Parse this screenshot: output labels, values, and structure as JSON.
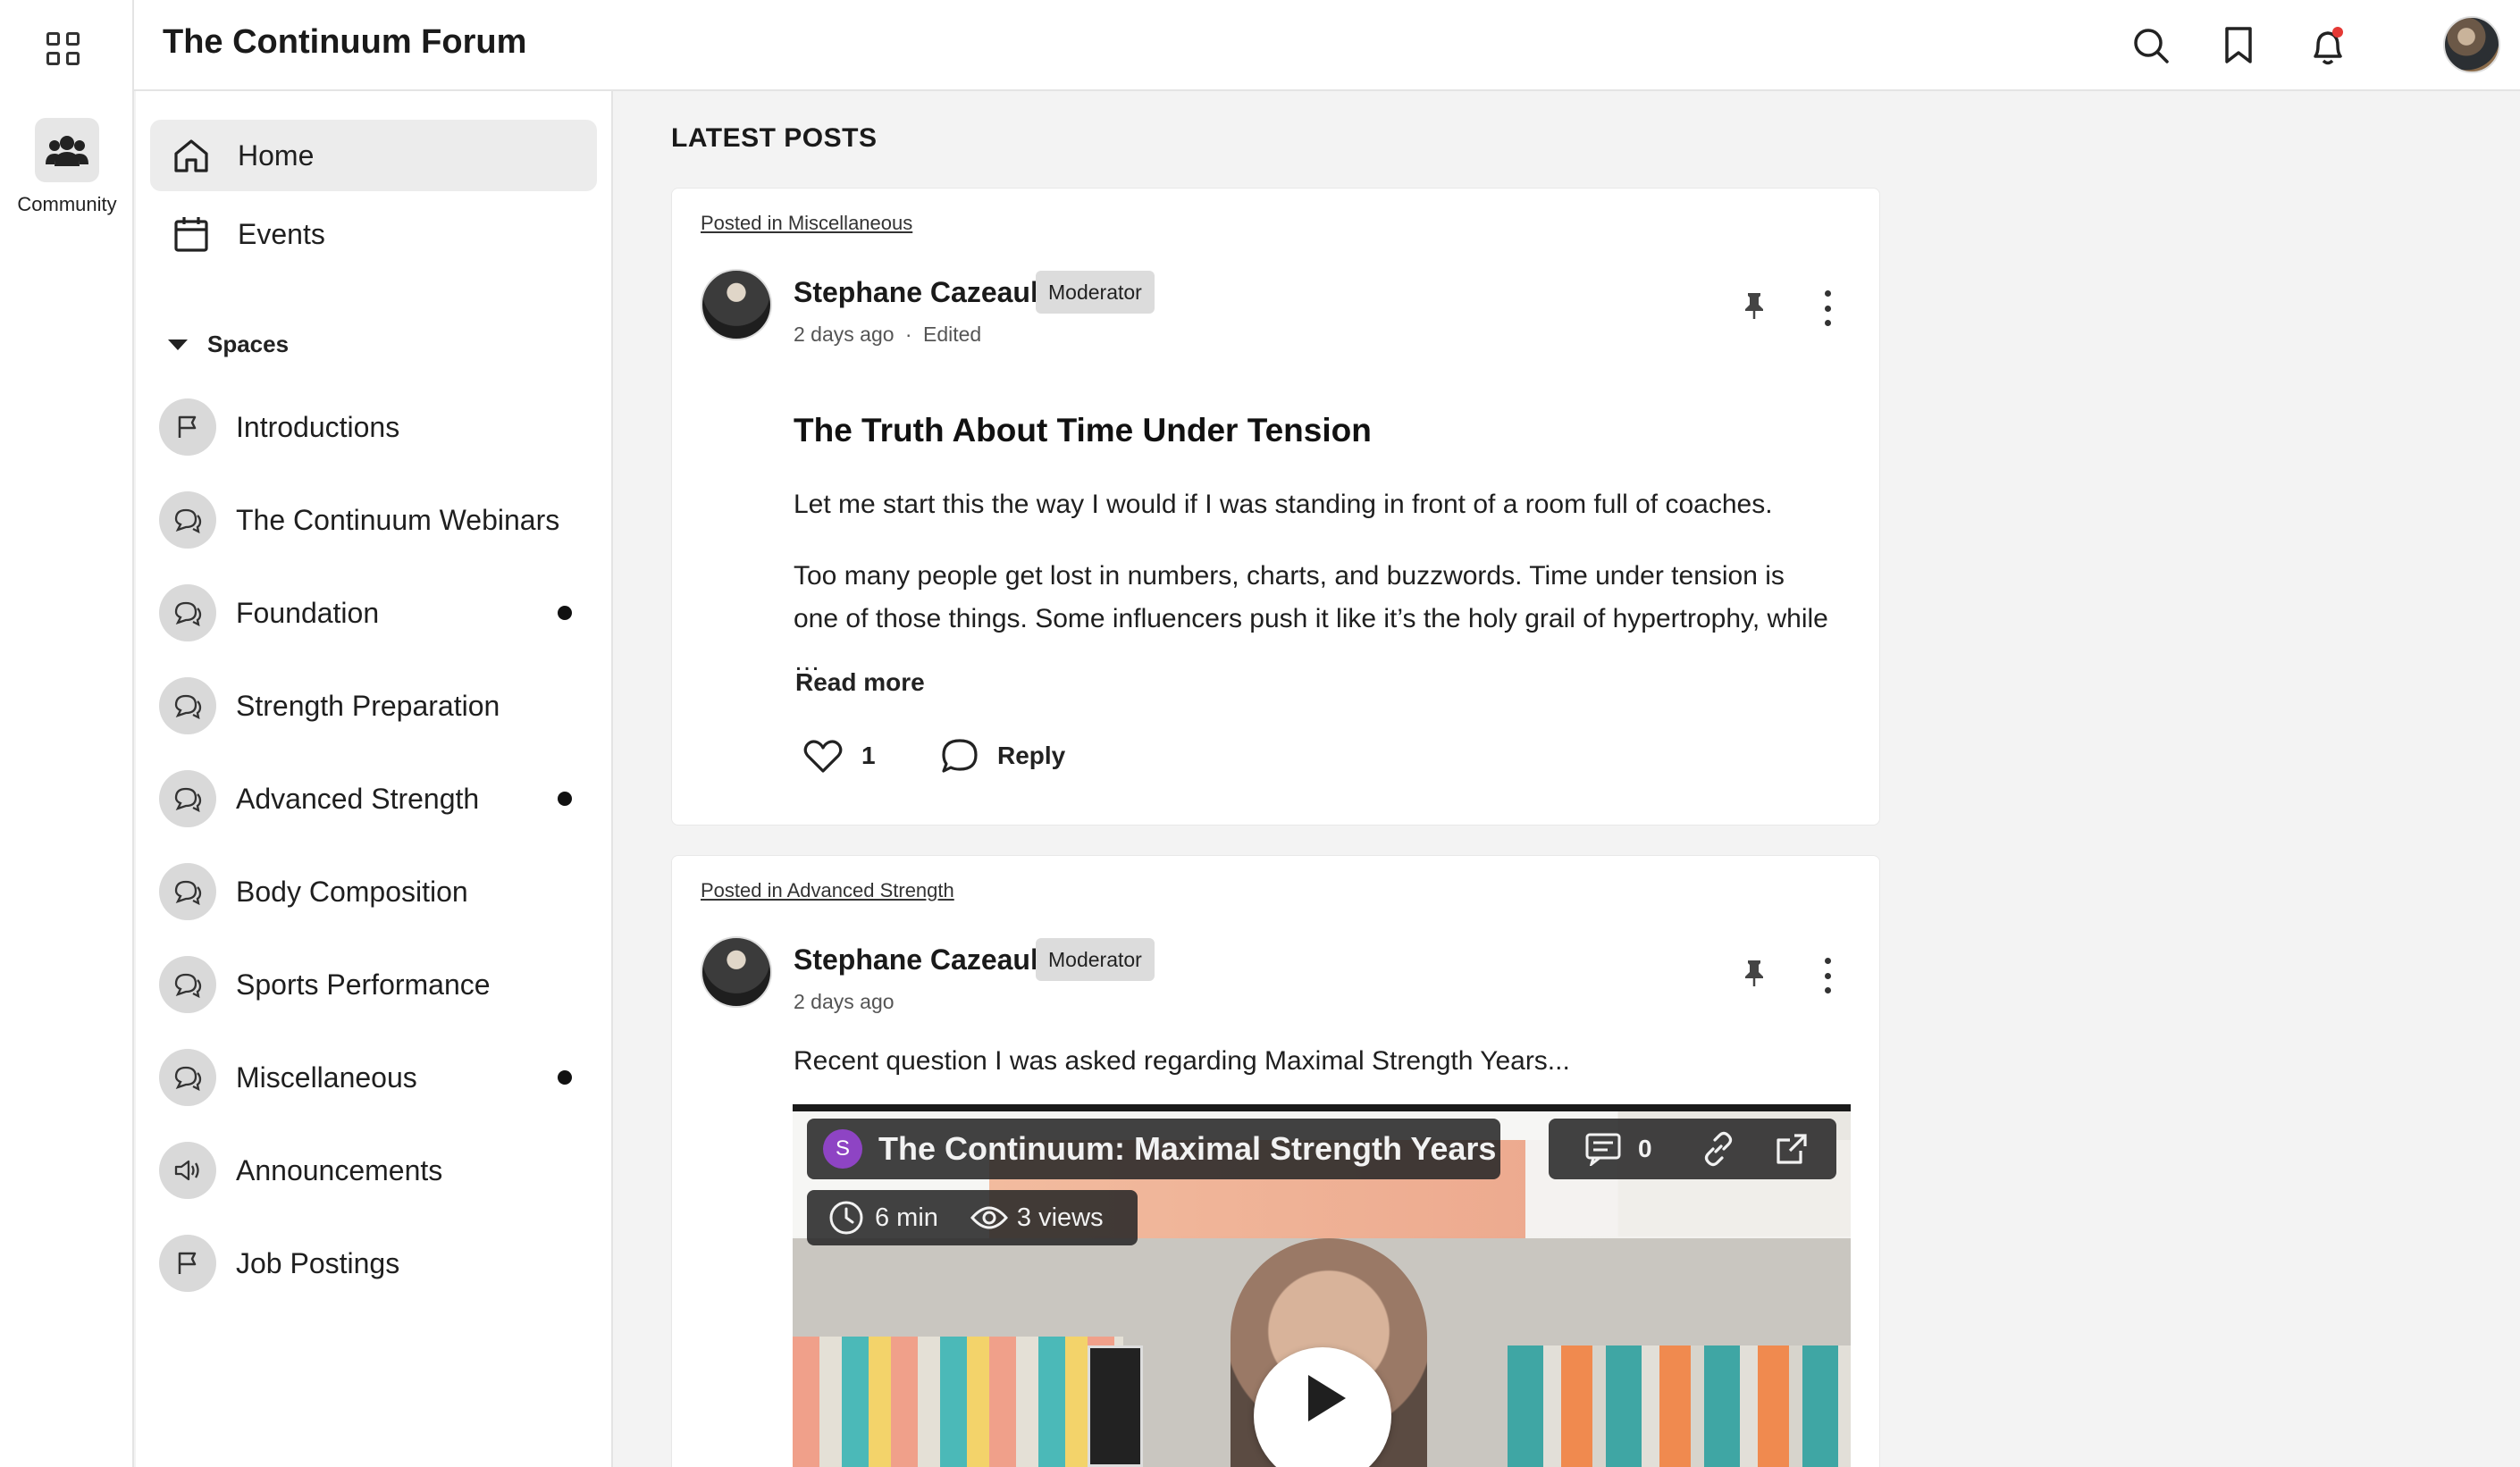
{
  "app": {
    "title": "The Continuum Forum",
    "rail_label": "Community"
  },
  "header": {
    "icons": [
      "search-icon",
      "bookmark-icon",
      "notification-bell-icon",
      "user-avatar"
    ],
    "notification_dot_color": "#e53935"
  },
  "nav": {
    "home": "Home",
    "events": "Events",
    "spaces_label": "Spaces"
  },
  "spaces": [
    {
      "label": "Introductions",
      "icon": "flag-icon",
      "unread": false
    },
    {
      "label": "The Continuum Webinars",
      "icon": "chat-icon",
      "unread": false
    },
    {
      "label": "Foundation",
      "icon": "chat-icon",
      "unread": true
    },
    {
      "label": "Strength Preparation",
      "icon": "chat-icon",
      "unread": false
    },
    {
      "label": "Advanced Strength",
      "icon": "chat-icon",
      "unread": true
    },
    {
      "label": "Body Composition",
      "icon": "chat-icon",
      "unread": false
    },
    {
      "label": "Sports Performance",
      "icon": "chat-icon",
      "unread": false
    },
    {
      "label": "Miscellaneous",
      "icon": "chat-icon",
      "unread": true
    },
    {
      "label": "Announcements",
      "icon": "megaphone-icon",
      "unread": false
    },
    {
      "label": "Job Postings",
      "icon": "flag-icon",
      "unread": false
    }
  ],
  "feed": {
    "section_title": "LATEST POSTS",
    "posts": [
      {
        "posted_in": "Posted in Miscellaneous",
        "author": "Stephane Cazeault",
        "role": "Moderator",
        "time": "2 days ago",
        "edited": "Edited",
        "separator": "·",
        "title": "The Truth About Time Under Tension",
        "paragraph1": "Let me start this the way I would if I was standing in front of a room full of coaches.",
        "paragraph2": "Too many people get lost in numbers, charts, and buzzwords. Time under tension is one of those things. Some influencers push it like it’s the holy grail of hypertrophy, while …",
        "read_more": "Read more",
        "likes": "1",
        "reply": "Reply"
      },
      {
        "posted_in": "Posted in Advanced Strength",
        "author": "Stephane Cazeault",
        "role": "Moderator",
        "time": "2 days ago",
        "body": "Recent question I was asked regarding Maximal Strength Years...",
        "video": {
          "channel_initial": "S",
          "title": "The Continuum: Maximal Strength Years",
          "comments": "0",
          "duration": "6 min",
          "views": "3 views"
        }
      }
    ]
  },
  "colors": {
    "accent_badge": "#dcdcdc",
    "video_avatar": "#8e44c4",
    "unread_dot": "#111111"
  }
}
